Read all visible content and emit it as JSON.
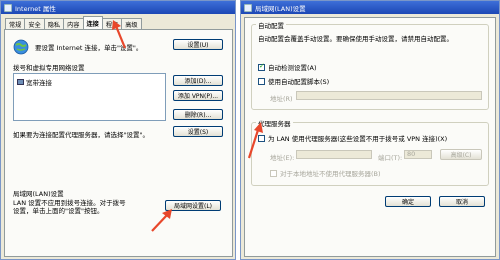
{
  "left_window": {
    "title": "Internet 属性",
    "tabs": [
      "常规",
      "安全",
      "隐私",
      "内容",
      "连接",
      "程序",
      "高级"
    ],
    "active_tab": "连接",
    "setup_text": "要设置 Internet 连接，单击\"设置\"。",
    "setup_button": "设置(U)",
    "dialup_section": "拨号和虚拟专用网络设置",
    "connections": [
      "宽带连接"
    ],
    "add_button": "添加(D)...",
    "add_vpn_button": "添加 VPN(P)...",
    "remove_button": "删除(R)...",
    "proxy_text": "如果要为连接配置代理服务器，请选择\"设置\"。",
    "settings_button": "设置(S)",
    "lan_section": "局域网(LAN)设置",
    "lan_text": "LAN 设置不应用到拨号连接。对于拨号设置，单击上面的\"设置\"按钮。",
    "lan_button": "局域网设置(L)"
  },
  "right_window": {
    "title": "局域网(LAN)设置",
    "auto_config": {
      "title": "自动配置",
      "description": "自动配置会覆盖手动设置。要确保使用手动设置，请禁用自动配置。",
      "auto_detect_label": "自动检测设置(A)",
      "auto_detect_checked": true,
      "use_script_label": "使用自动配置脚本(S)",
      "use_script_checked": false,
      "address_label": "地址(R)"
    },
    "proxy": {
      "title": "代理服务器",
      "use_proxy_label": "为 LAN 使用代理服务器(这些设置不用于拨号或 VPN 连接)(X)",
      "use_proxy_checked": false,
      "address_label": "地址(E):",
      "port_label": "端口(T):",
      "port_value": "80",
      "advanced_button": "高级(C)",
      "bypass_label": "对于本地地址不使用代理服务器(B)"
    },
    "ok_button": "确定",
    "cancel_button": "取消"
  },
  "colors": {
    "arrow": "#e8472b",
    "title_bar": "#2858c8"
  }
}
